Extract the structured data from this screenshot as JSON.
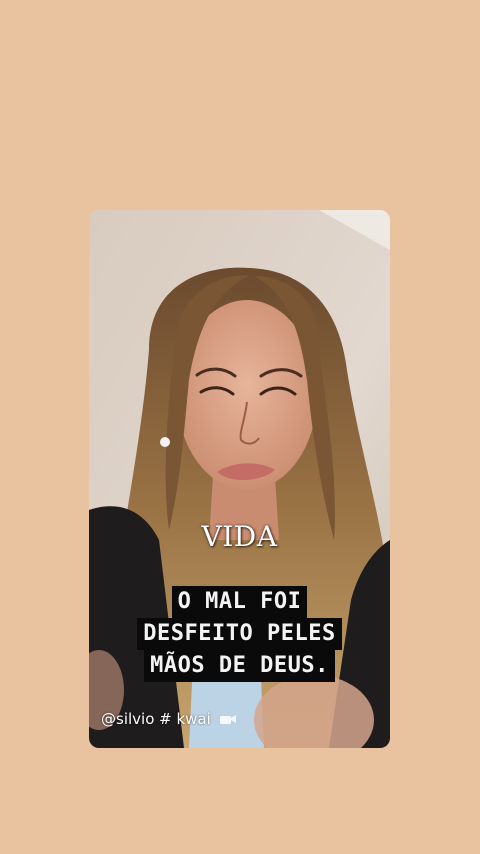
{
  "background_color": "#e9c3a0",
  "video": {
    "caption_title": "VIDA",
    "caption_lines": [
      "O MAL FOI",
      "DESFEITO PELES",
      "MÃOS DE DEUS."
    ],
    "watermark": "@silvio # kwai",
    "watermark_icon": "camera-icon"
  }
}
